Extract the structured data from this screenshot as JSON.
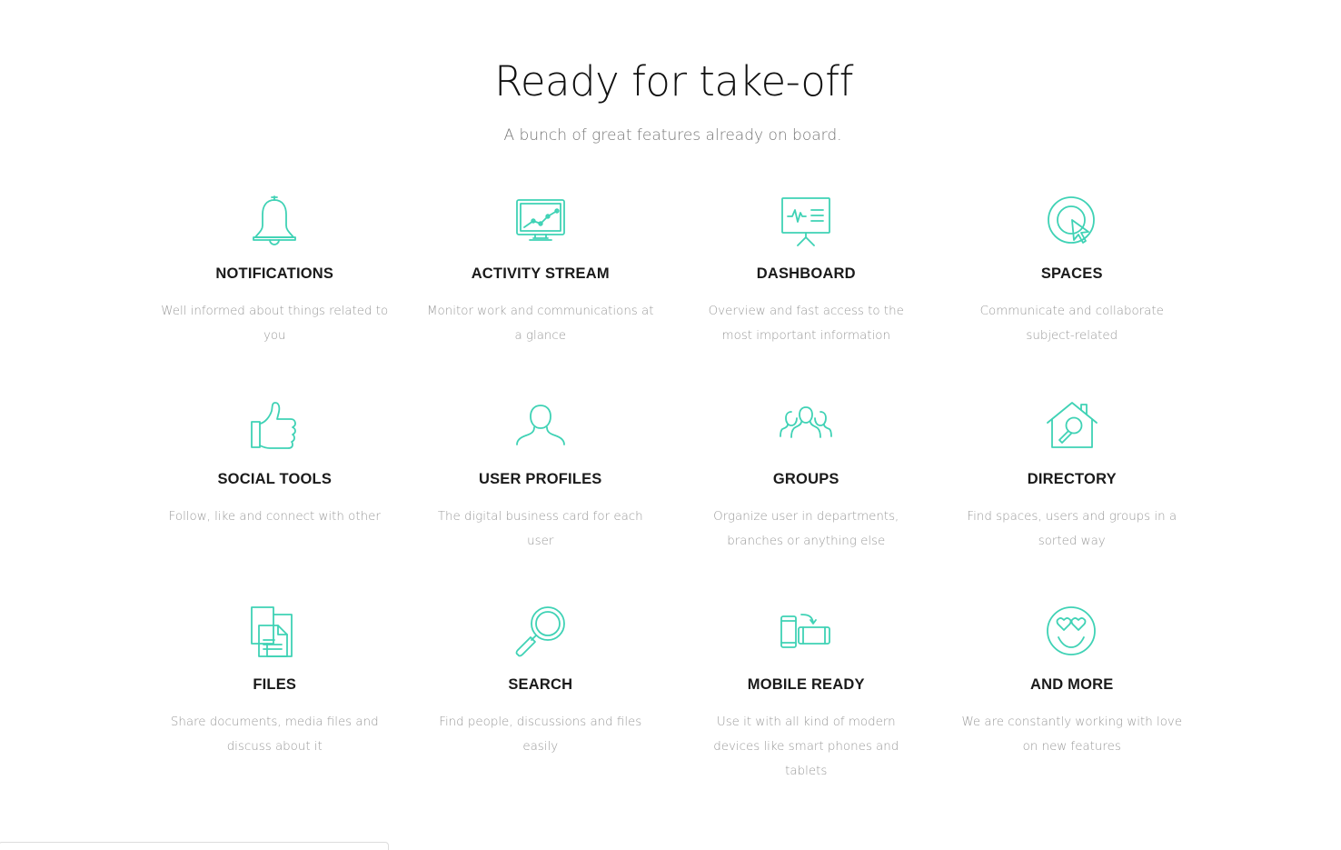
{
  "section": {
    "title": "Ready for take-off",
    "subtitle": "A bunch of great features already on board."
  },
  "accent_color": "#3fd2b5",
  "features": [
    {
      "icon": "bell-icon",
      "title": "NOTIFICATIONS",
      "desc": "Well informed about things related to you"
    },
    {
      "icon": "monitor-chart-icon",
      "title": "ACTIVITY STREAM",
      "desc": "Monitor work and communications at a glance"
    },
    {
      "icon": "presentation-board-icon",
      "title": "DASHBOARD",
      "desc": "Overview and fast access to the most important information"
    },
    {
      "icon": "target-cursor-icon",
      "title": "SPACES",
      "desc": "Communicate and collaborate subject-related"
    },
    {
      "icon": "thumbs-up-icon",
      "title": "SOCIAL TOOLS",
      "desc": "Follow, like and connect with other"
    },
    {
      "icon": "user-icon",
      "title": "USER PROFILES",
      "desc": "The digital business card for each user"
    },
    {
      "icon": "group-icon",
      "title": "GROUPS",
      "desc": "Organize user in departments, branches or anything else"
    },
    {
      "icon": "house-search-icon",
      "title": "DIRECTORY",
      "desc": "Find spaces, users and groups in a sorted way"
    },
    {
      "icon": "files-icon",
      "title": "FILES",
      "desc": "Share documents, media files and discuss about it"
    },
    {
      "icon": "magnifier-icon",
      "title": "SEARCH",
      "desc": "Find people, discussions and files easily"
    },
    {
      "icon": "mobile-rotate-icon",
      "title": "MOBILE READY",
      "desc": "Use it with all kind of modern devices like smart phones and tablets"
    },
    {
      "icon": "smiley-heart-eyes-icon",
      "title": "AND MORE",
      "desc": "We are constantly working with love on new features"
    }
  ]
}
